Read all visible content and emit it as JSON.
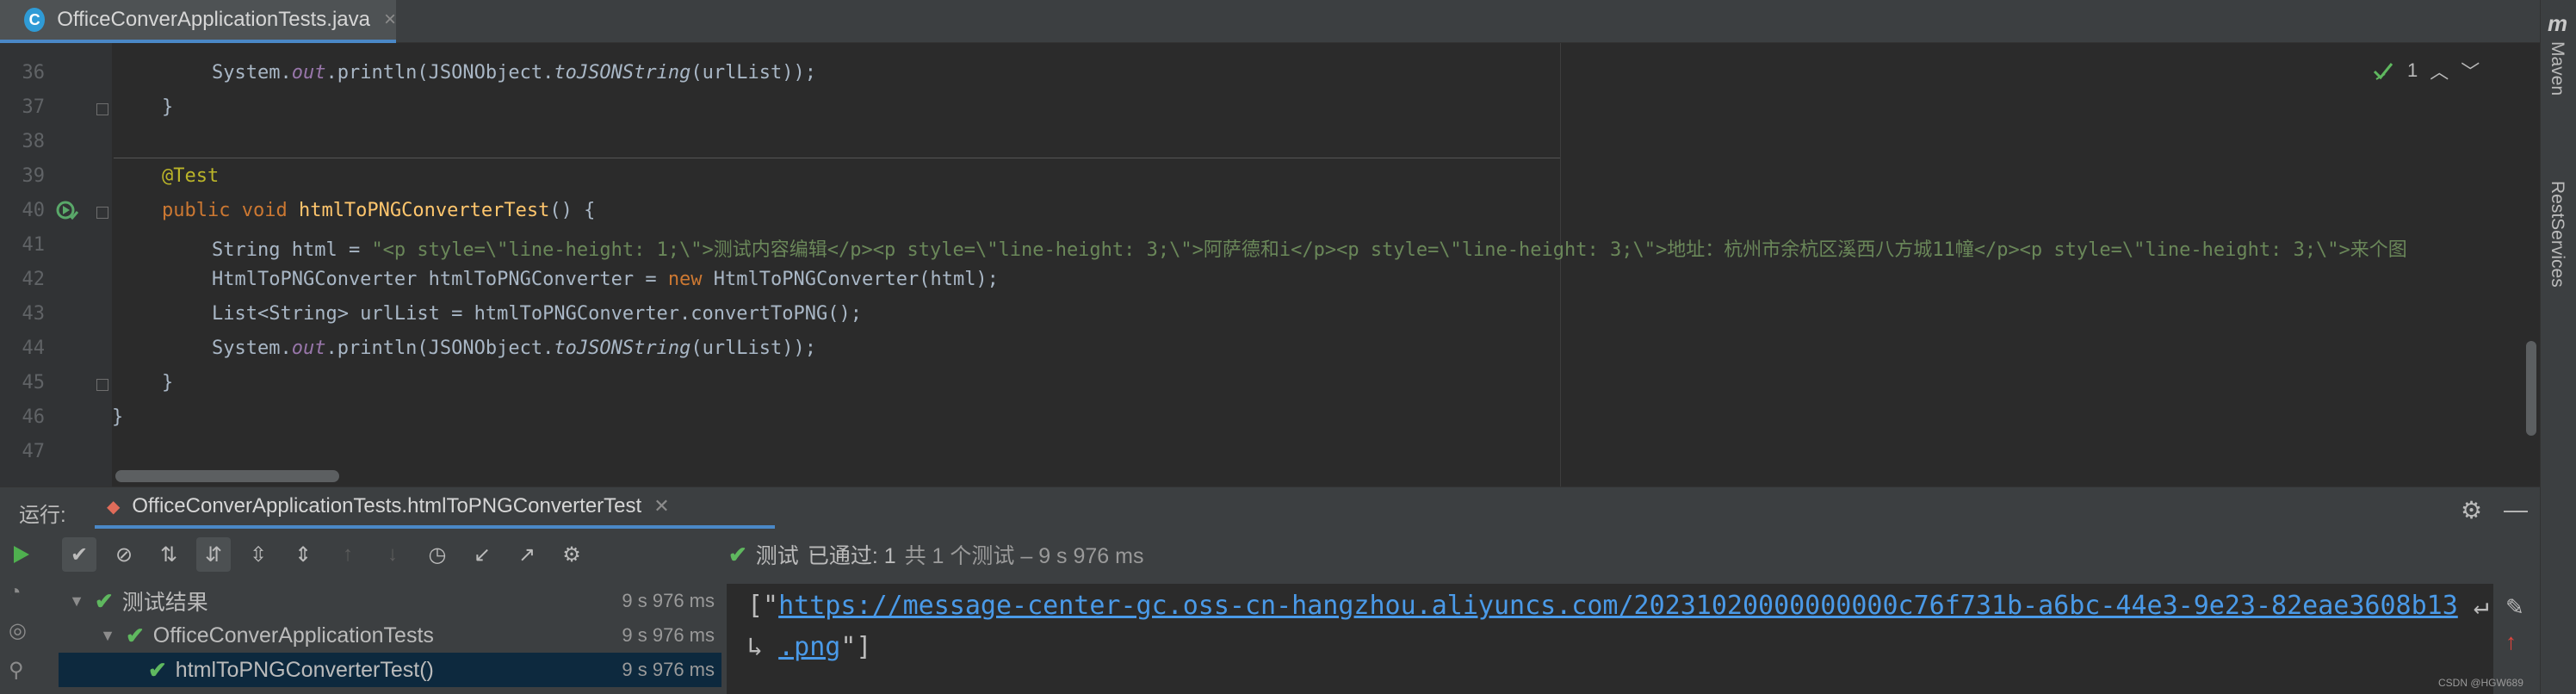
{
  "editor_tab": {
    "title": "OfficeConverApplicationTests.java",
    "close": "×"
  },
  "right_strip": {
    "logo": "m",
    "maven": "Maven",
    "rest": "RestServices"
  },
  "inspections": {
    "count": "1"
  },
  "code": {
    "lines": [
      "36",
      "37",
      "38",
      "39",
      "40",
      "41",
      "42",
      "43",
      "44",
      "45",
      "46",
      "47"
    ],
    "l36": {
      "a": "System.",
      "b": "out",
      "c": ".println(JSONObject.",
      "d": "toJSONString",
      "e": "(urlList));"
    },
    "l37": "}",
    "l39": "@Test",
    "l40": {
      "kw": "public void ",
      "fn": "htmlToPNGConverterTest",
      "rest": "() {"
    },
    "l41": {
      "a": "String html = ",
      "str": "\"<p style=\\\"line-height: 1;\\\">测试内容编辑</p><p style=\\\"line-height: 3;\\\">阿萨德和i</p><p style=\\\"line-height: 3;\\\">地址：杭州市余杭区溪西八方城11幢</p><p style=\\\"line-height: 3;\\\">来个图"
    },
    "l42": {
      "a": "HtmlToPNGConverter htmlToPNGConverter = ",
      "kw": "new ",
      "b": "HtmlToPNGConverter(html);"
    },
    "l43": {
      "a": "List<String> urlList = htmlToPNGConverter.convertToPNG();"
    },
    "l44": {
      "a": "System.",
      "b": "out",
      "c": ".println(JSONObject.",
      "d": "toJSONString",
      "e": "(urlList));"
    },
    "l45": "}",
    "l46": "}"
  },
  "run": {
    "label": "运行:",
    "tab": "OfficeConverApplicationTests.htmlToPNGConverterTest",
    "status_prefix": "测试",
    "status_passed": "已通过: 1",
    "status_detail": "共 1 个测试 – 9 s 976 ms",
    "tree": [
      {
        "name": "测试结果",
        "time": "9 s 976 ms"
      },
      {
        "name": "OfficeConverApplicationTests",
        "time": "9 s 976 ms"
      },
      {
        "name": "htmlToPNGConverterTest()",
        "time": "9 s 976 ms"
      }
    ],
    "console": {
      "open": "[\"",
      "url_1": "https://message-center-gc.oss-cn-hangzhou.aliyuncs.com/20231020000000000c76f731b-a6bc-44e3-9e23-82eae3608b13",
      "url_2": ".png",
      "close": "\"]"
    }
  },
  "watermark": "CSDN @HGW689"
}
